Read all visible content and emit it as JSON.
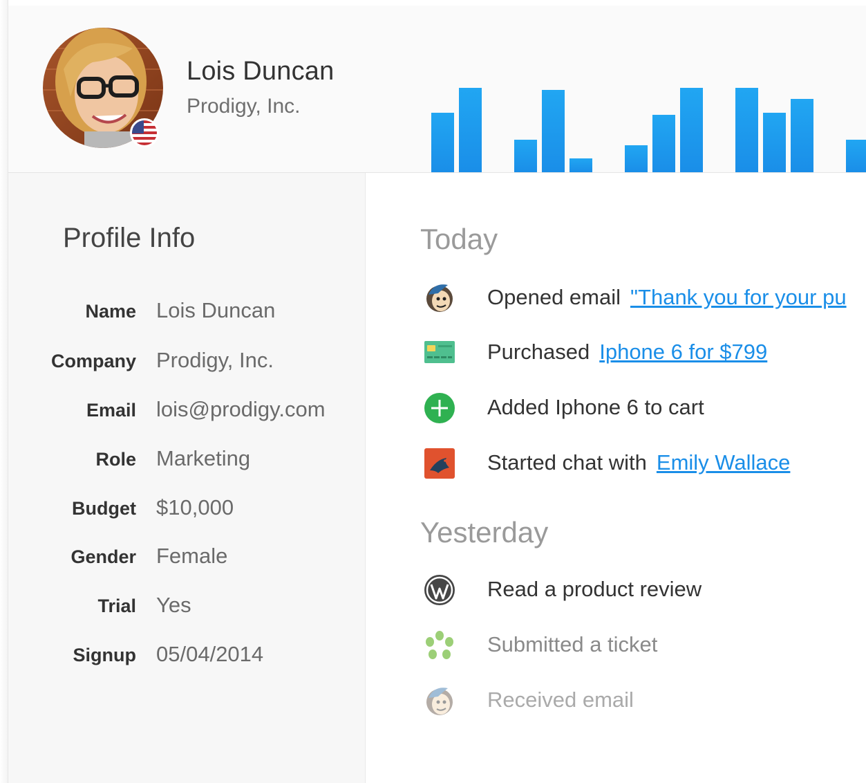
{
  "profile_header": {
    "name": "Lois Duncan",
    "company": "Prodigy, Inc."
  },
  "activity_chart": {
    "bar_color": "#1a8ee8",
    "heights": [
      0.66,
      0.93,
      0,
      0.36,
      0.91,
      0.15,
      0,
      0.3,
      0.63,
      0.93,
      0,
      0.93,
      0.66,
      0.81,
      0,
      0.36
    ]
  },
  "profile_info": {
    "title": "Profile Info",
    "fields": [
      {
        "label": "Name",
        "value": "Lois Duncan"
      },
      {
        "label": "Company",
        "value": "Prodigy, Inc."
      },
      {
        "label": "Email",
        "value": "lois@prodigy.com"
      },
      {
        "label": "Role",
        "value": "Marketing"
      },
      {
        "label": "Budget",
        "value": "$10,000"
      },
      {
        "label": "Gender",
        "value": "Female"
      },
      {
        "label": "Trial",
        "value": "Yes"
      },
      {
        "label": "Signup",
        "value": "05/04/2014"
      }
    ]
  },
  "timeline": {
    "today_title": "Today",
    "today": [
      {
        "icon": "mailchimp-icon",
        "text": "Opened email",
        "link": "\"Thank you for your pu"
      },
      {
        "icon": "credit-card-icon",
        "text": "Purchased",
        "link": "Iphone 6 for $799"
      },
      {
        "icon": "add-to-cart-icon",
        "text": "Added Iphone 6 to cart",
        "link": ""
      },
      {
        "icon": "chat-bird-icon",
        "text": "Started chat with",
        "link": "Emily Wallace"
      }
    ],
    "yesterday_title": "Yesterday",
    "yesterday": [
      {
        "icon": "wordpress-icon",
        "text": "Read a product review"
      },
      {
        "icon": "zendesk-icon",
        "text": "Submitted a ticket"
      },
      {
        "icon": "mailchimp-icon",
        "text": "Received email"
      }
    ]
  },
  "colors": {
    "link": "#1a8ee8",
    "bar": "#1a8ee8",
    "add_green": "#2fb151",
    "chat_orange": "#e0522e"
  }
}
